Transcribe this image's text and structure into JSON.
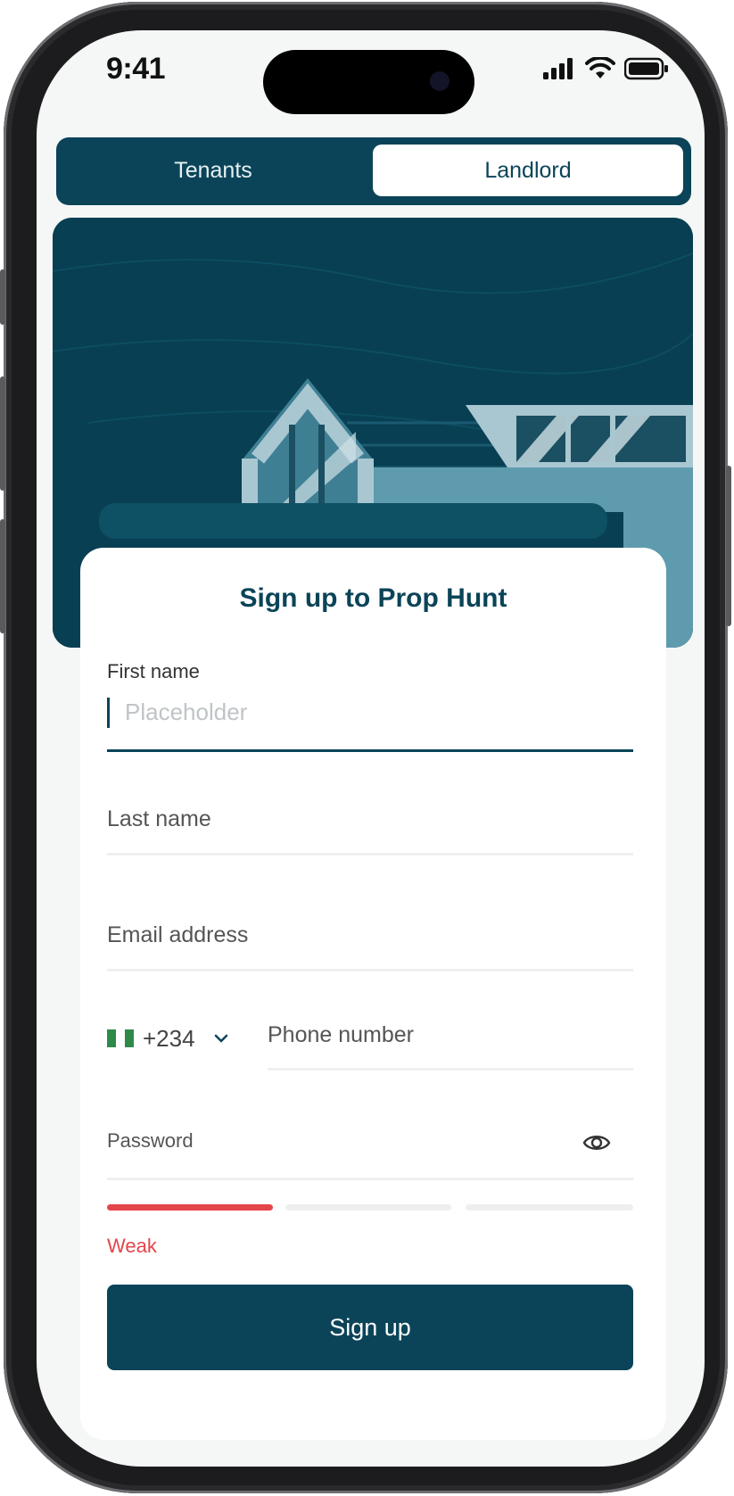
{
  "status_bar": {
    "time": "9:41"
  },
  "segmented": {
    "tabs": [
      "Tenants",
      "Landlord"
    ],
    "active": "Landlord"
  },
  "form": {
    "title": "Sign up to Prop Hunt",
    "first_name": {
      "label": "First name",
      "placeholder": "Placeholder"
    },
    "last_name": {
      "label": "Last name"
    },
    "email": {
      "label": "Email address"
    },
    "phone": {
      "country_code": "+234",
      "flag": "nigeria-flag",
      "label": "Phone number"
    },
    "password": {
      "label": "Password",
      "strength_label": "Weak",
      "strength_level": 1,
      "strength_max": 3
    },
    "submit_label": "Sign up"
  },
  "colors": {
    "brand": "#0b4458",
    "weak": "#e4454a",
    "background": "#f4f7f6"
  }
}
